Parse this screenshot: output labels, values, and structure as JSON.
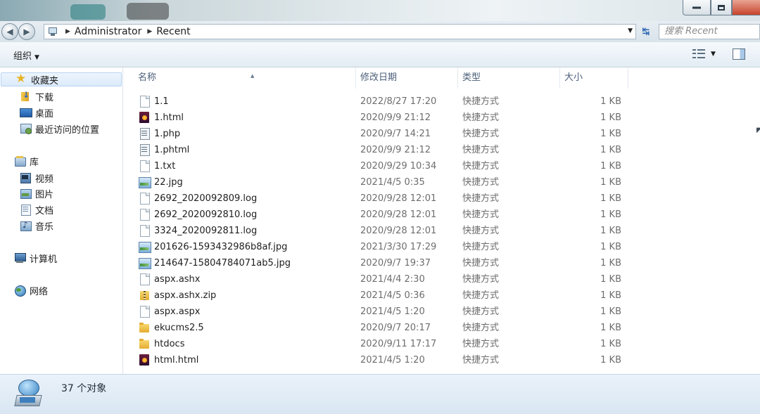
{
  "window": {
    "title_controls": [
      "minimize",
      "maximize",
      "close"
    ]
  },
  "address": {
    "breadcrumbs": [
      "Administrator",
      "Recent"
    ],
    "search_placeholder": "搜索 Recent"
  },
  "toolbar": {
    "organize_label": "组织"
  },
  "nav": {
    "favorites_header": "收藏夹",
    "favorites": [
      {
        "label": "下载",
        "icon": "downloads-folder-icon"
      },
      {
        "label": "桌面",
        "icon": "desktop-icon"
      },
      {
        "label": "最近访问的位置",
        "icon": "recent-places-icon"
      }
    ],
    "libraries_header": "库",
    "libraries": [
      {
        "label": "视频",
        "icon": "video-library-icon"
      },
      {
        "label": "图片",
        "icon": "picture-library-icon"
      },
      {
        "label": "文档",
        "icon": "document-library-icon"
      },
      {
        "label": "音乐",
        "icon": "music-library-icon"
      }
    ],
    "computer_label": "计算机",
    "network_label": "网络"
  },
  "columns": {
    "name": "名称",
    "date": "修改日期",
    "type": "类型",
    "size": "大小"
  },
  "files": [
    {
      "name": "1.1",
      "date": "2022/8/27 17:20",
      "type": "快捷方式",
      "size": "1 KB",
      "icon": "file"
    },
    {
      "name": "1.html",
      "date": "2020/9/9 21:12",
      "type": "快捷方式",
      "size": "1 KB",
      "icon": "html"
    },
    {
      "name": "1.php",
      "date": "2020/9/7 14:21",
      "type": "快捷方式",
      "size": "1 KB",
      "icon": "php"
    },
    {
      "name": "1.phtml",
      "date": "2020/9/9 21:12",
      "type": "快捷方式",
      "size": "1 KB",
      "icon": "php"
    },
    {
      "name": "1.txt",
      "date": "2020/9/29 10:34",
      "type": "快捷方式",
      "size": "1 KB",
      "icon": "file"
    },
    {
      "name": "22.jpg",
      "date": "2021/4/5 0:35",
      "type": "快捷方式",
      "size": "1 KB",
      "icon": "image"
    },
    {
      "name": "2692_2020092809.log",
      "date": "2020/9/28 12:01",
      "type": "快捷方式",
      "size": "1 KB",
      "icon": "file"
    },
    {
      "name": "2692_2020092810.log",
      "date": "2020/9/28 12:01",
      "type": "快捷方式",
      "size": "1 KB",
      "icon": "file"
    },
    {
      "name": "3324_2020092811.log",
      "date": "2020/9/28 12:01",
      "type": "快捷方式",
      "size": "1 KB",
      "icon": "file"
    },
    {
      "name": "201626-1593432986b8af.jpg",
      "date": "2021/3/30 17:29",
      "type": "快捷方式",
      "size": "1 KB",
      "icon": "image"
    },
    {
      "name": "214647-15804784071ab5.jpg",
      "date": "2020/9/7 19:37",
      "type": "快捷方式",
      "size": "1 KB",
      "icon": "image"
    },
    {
      "name": "aspx.ashx",
      "date": "2021/4/4 2:30",
      "type": "快捷方式",
      "size": "1 KB",
      "icon": "file"
    },
    {
      "name": "aspx.ashx.zip",
      "date": "2021/4/5 0:36",
      "type": "快捷方式",
      "size": "1 KB",
      "icon": "zip"
    },
    {
      "name": "aspx.aspx",
      "date": "2021/4/5 1:20",
      "type": "快捷方式",
      "size": "1 KB",
      "icon": "file"
    },
    {
      "name": "ekucms2.5",
      "date": "2020/9/7 20:17",
      "type": "快捷方式",
      "size": "1 KB",
      "icon": "folder"
    },
    {
      "name": "htdocs",
      "date": "2020/9/11 17:17",
      "type": "快捷方式",
      "size": "1 KB",
      "icon": "folder"
    },
    {
      "name": "html.html",
      "date": "2021/4/5 1:20",
      "type": "快捷方式",
      "size": "1 KB",
      "icon": "html"
    }
  ],
  "status": {
    "count_text": "37 个对象"
  }
}
